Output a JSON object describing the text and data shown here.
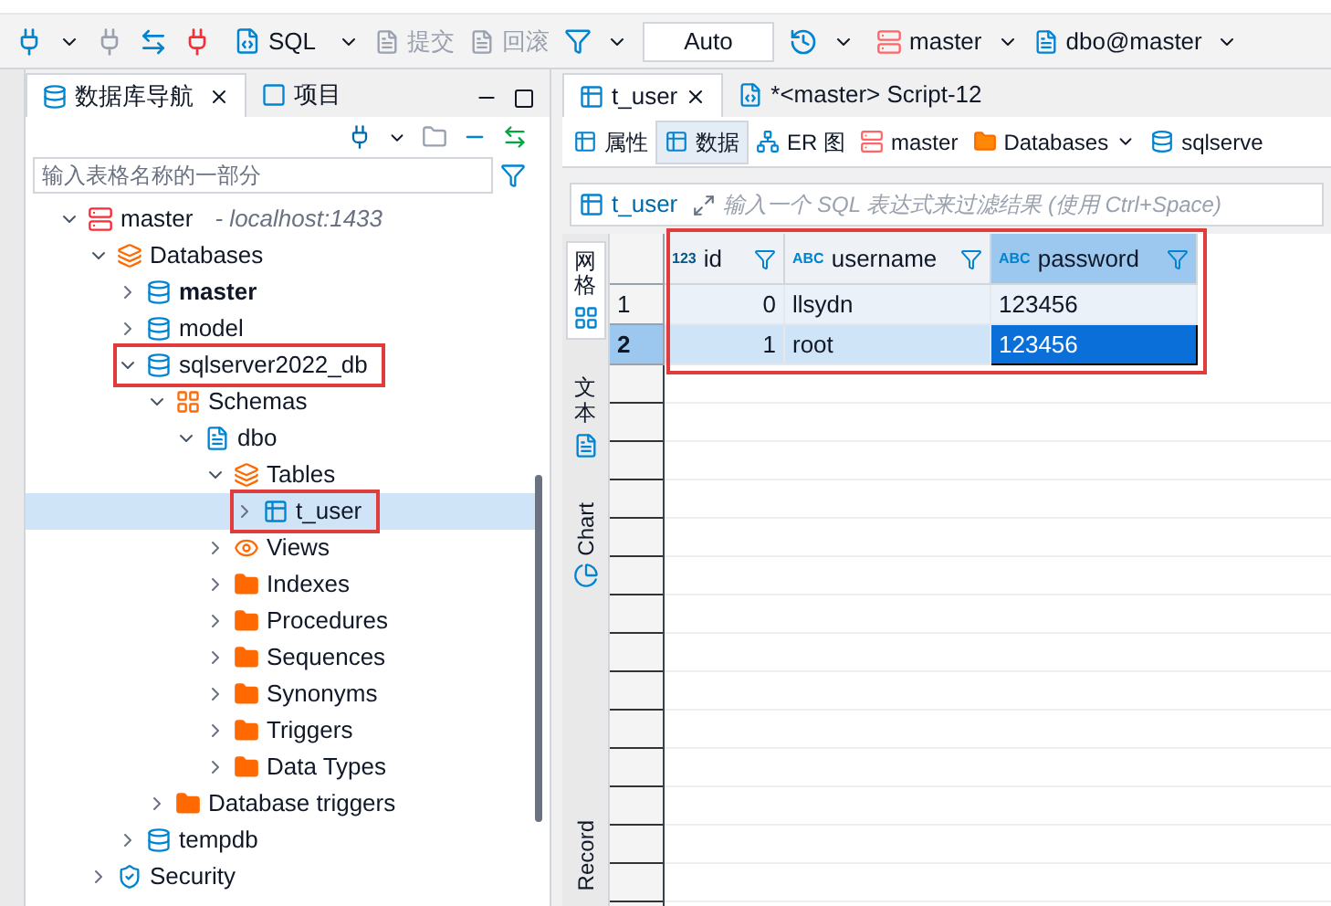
{
  "toolbar": {
    "sql_button": "SQL",
    "commit": {
      "label": "提交",
      "disabled": true
    },
    "rollback": {
      "label": "回滚",
      "disabled": true
    },
    "transaction_mode": "Auto",
    "connection": "master",
    "schema": "dbo@master"
  },
  "navigator": {
    "tabs": [
      {
        "label": "数据库导航",
        "selected": true
      },
      {
        "label": "项目",
        "selected": false
      }
    ],
    "filter": {
      "placeholder": "输入表格名称的一部分"
    },
    "tree": [
      {
        "label": "master",
        "kind": "connection",
        "subtitle": "- localhost:1433",
        "expanded": true,
        "children": [
          {
            "label": "Databases",
            "kind": "folder-list",
            "expanded": true,
            "children": [
              {
                "label": "master",
                "kind": "database",
                "bold": true,
                "expanded": false
              },
              {
                "label": "model",
                "kind": "database",
                "expanded": false
              },
              {
                "label": "sqlserver2022_db",
                "kind": "database",
                "expanded": true,
                "highlighted": true,
                "children": [
                  {
                    "label": "Schemas",
                    "kind": "schemas",
                    "expanded": true,
                    "children": [
                      {
                        "label": "dbo",
                        "kind": "schema",
                        "expanded": true,
                        "children": [
                          {
                            "label": "Tables",
                            "kind": "tables",
                            "expanded": true,
                            "children": [
                              {
                                "label": "t_user",
                                "kind": "table",
                                "expanded": false,
                                "selected": true,
                                "highlighted": true
                              }
                            ]
                          },
                          {
                            "label": "Views",
                            "kind": "views",
                            "expanded": false
                          },
                          {
                            "label": "Indexes",
                            "kind": "folder",
                            "expanded": false
                          },
                          {
                            "label": "Procedures",
                            "kind": "folder",
                            "expanded": false
                          },
                          {
                            "label": "Sequences",
                            "kind": "folder",
                            "expanded": false
                          },
                          {
                            "label": "Synonyms",
                            "kind": "folder",
                            "expanded": false
                          },
                          {
                            "label": "Triggers",
                            "kind": "folder",
                            "expanded": false
                          },
                          {
                            "label": "Data Types",
                            "kind": "folder",
                            "expanded": false
                          }
                        ]
                      }
                    ]
                  },
                  {
                    "label": "Database triggers",
                    "kind": "folder",
                    "expanded": false
                  }
                ]
              },
              {
                "label": "tempdb",
                "kind": "database",
                "expanded": false
              }
            ]
          },
          {
            "label": "Security",
            "kind": "security",
            "expanded": false
          }
        ]
      }
    ]
  },
  "editor": {
    "tabs": [
      {
        "label": "t_user",
        "kind": "table",
        "selected": true
      },
      {
        "label": "*<master> Script-12",
        "kind": "script",
        "selected": false
      }
    ],
    "subtabs": [
      {
        "label": "属性",
        "kind": "props",
        "selected": false
      },
      {
        "label": "数据",
        "kind": "data",
        "selected": true
      },
      {
        "label": "ER 图",
        "kind": "er",
        "selected": false
      }
    ],
    "breadcrumbs": [
      {
        "label": "master",
        "kind": "connection"
      },
      {
        "label": "Databases",
        "kind": "folder"
      },
      {
        "label": "sqlserve",
        "kind": "database"
      }
    ],
    "filter": {
      "table": "t_user",
      "placeholder": "输入一个 SQL 表达式来过滤结果 (使用 Ctrl+Space)"
    },
    "side_tabs": [
      {
        "label": "网格",
        "kind": "grid",
        "selected": true
      },
      {
        "label": "文本",
        "kind": "text",
        "selected": false
      },
      {
        "label": "Chart",
        "kind": "chart",
        "selected": false
      },
      {
        "label": "Record",
        "kind": "record",
        "selected": false
      }
    ],
    "grid": {
      "highlighted": true,
      "columns": [
        {
          "label": "id",
          "type_label": "123",
          "kind": "number",
          "selected": false
        },
        {
          "label": "username",
          "type_label": "ABC",
          "kind": "text",
          "selected": false
        },
        {
          "label": "password",
          "type_label": "ABC",
          "kind": "text",
          "selected": true
        }
      ],
      "rows": [
        {
          "number": "1",
          "selected": false,
          "cells": [
            {
              "text": "0",
              "selected": false
            },
            {
              "text": "llsydn",
              "selected": false
            },
            {
              "text": "123456",
              "selected": false
            }
          ]
        },
        {
          "number": "2",
          "selected": true,
          "cells": [
            {
              "text": "1",
              "selected": false
            },
            {
              "text": "root",
              "selected": false
            },
            {
              "text": "123456",
              "selected": true
            }
          ]
        }
      ]
    }
  }
}
